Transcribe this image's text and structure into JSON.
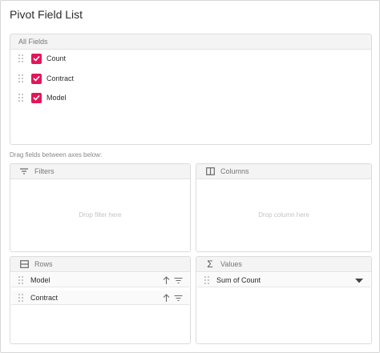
{
  "dialog": {
    "title": "Pivot Field List"
  },
  "all_fields": {
    "header": "All Fields",
    "items": [
      {
        "label": "Count",
        "checked": true
      },
      {
        "label": "Contract",
        "checked": true
      },
      {
        "label": "Model",
        "checked": true
      }
    ]
  },
  "hint": "Drag fields between axes below:",
  "axes": {
    "filters": {
      "header": "Filters",
      "placeholder": "Drop filter here"
    },
    "columns": {
      "header": "Columns",
      "placeholder": "Drop column here"
    },
    "rows": {
      "header": "Rows",
      "items": [
        "Model",
        "Contract"
      ]
    },
    "values": {
      "header": "Values",
      "items": [
        "Sum of Count"
      ]
    }
  },
  "colors": {
    "accent": "#e3165b",
    "header_bg": "#f4f4f4",
    "border": "#dcdcdc"
  },
  "icons": [
    "drag-grip-icon",
    "checkbox-checked-icon",
    "filter-icon",
    "columns-icon",
    "rows-icon",
    "sigma-icon",
    "sort-ascending-icon",
    "filter-lines-icon",
    "caret-down-icon"
  ]
}
